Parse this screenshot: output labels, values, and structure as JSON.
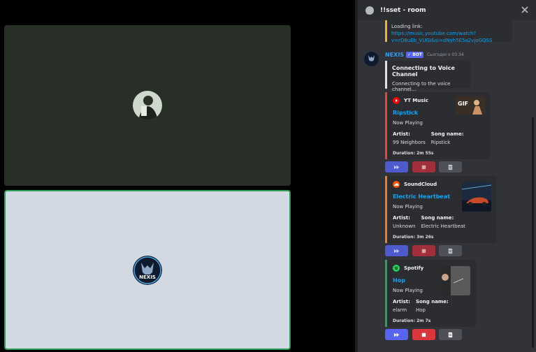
{
  "channel": {
    "title": "!!sset - room"
  },
  "loading_embed": {
    "label": "Loading link:",
    "link": "https://music.youtube.com/watch?v=rD8uEb_VUGI&si=dNyh5E5a2vjoGQSS"
  },
  "message": {
    "username": "NEXIS",
    "bot_tag": "BOT",
    "timestamp": "Сьогодні о 03:34"
  },
  "connect_embed": {
    "title": "Connecting to Voice Channel",
    "description": "Connecting to the voice channel..."
  },
  "cards": [
    {
      "source": "YT Music",
      "song_title": "Ripstick",
      "status": "Now Playing",
      "artist_label": "Artist:",
      "artist": "99 Neighbors",
      "song_label": "Song name:",
      "song_name": "Ripstick",
      "duration": "Duration: 2m 55s",
      "accent": "#ed4245",
      "thumb_text": "GIF"
    },
    {
      "source": "SoundCloud",
      "song_title": "Electric Heartbeat",
      "status": "Now Playing",
      "artist_label": "Artist:",
      "artist": "Unknown",
      "song_label": "Song name:",
      "song_name": "Electric Heartbeat",
      "duration": "Duration: 3m 26s",
      "accent": "#f47b20"
    },
    {
      "source": "Spotify",
      "song_title": "Hop",
      "status": "Now Playing",
      "artist_label": "Artist:",
      "artist": "elarm",
      "song_label": "Song name:",
      "song_name": "Hop",
      "duration": "Duration: 2m 7s",
      "accent": "#23a55a"
    }
  ],
  "video_tiles": [
    {
      "name": "user-avatar"
    },
    {
      "name": "nexis-avatar",
      "text": "NEXIS"
    }
  ],
  "colors": {
    "accent": "#5865f2",
    "link": "#00a8fc",
    "speaking": "#2d9d57"
  }
}
